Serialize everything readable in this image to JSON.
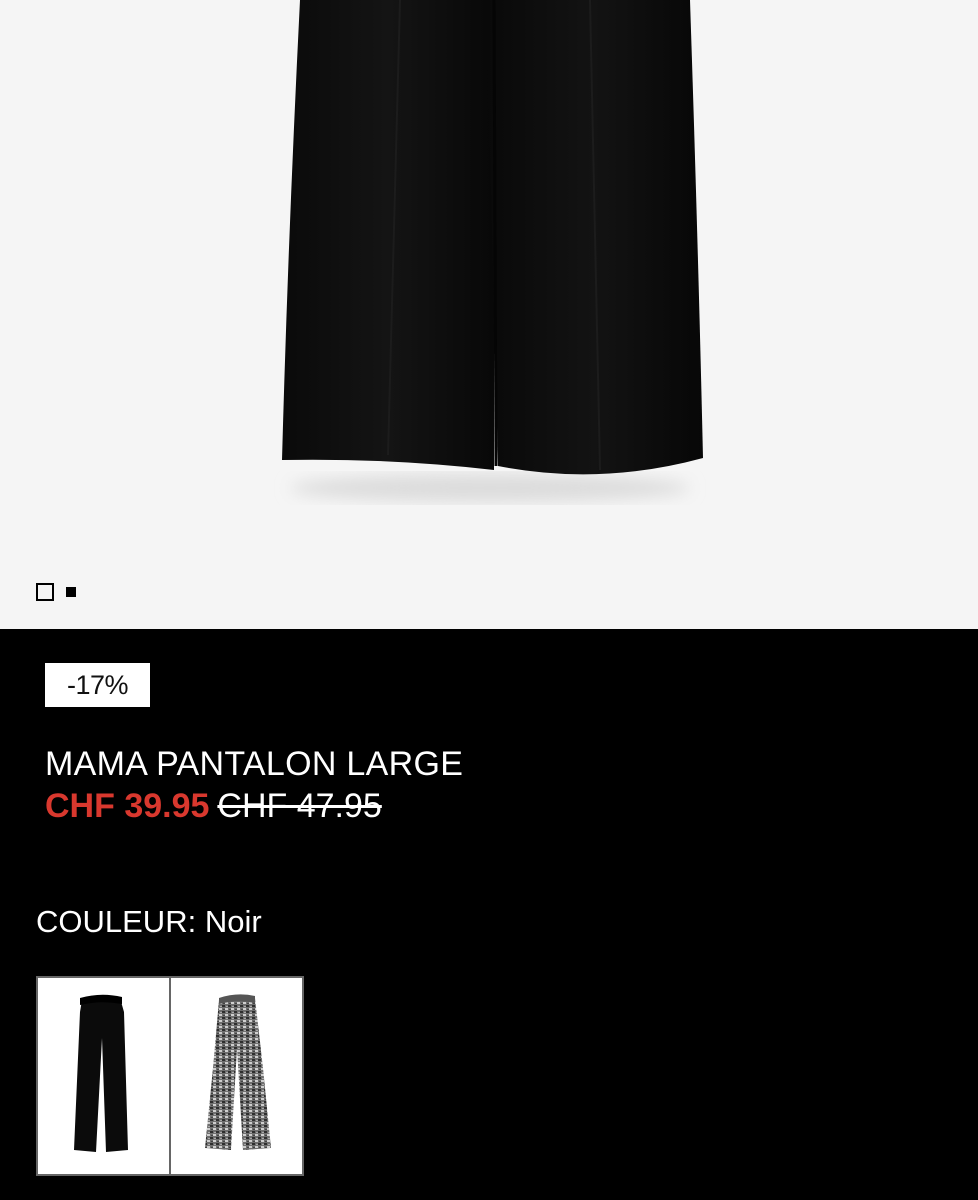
{
  "gallery": {
    "image_icon": "product-photo-black-wide-leg-trousers",
    "dots": [
      "gallery-dot-1",
      "gallery-dot-2"
    ]
  },
  "product": {
    "discount_badge": "-17%",
    "title": "MAMA PANTALON LARGE",
    "price_sale": "CHF 39.95",
    "price_original": "CHF 47.95",
    "color_label": "COULEUR:",
    "color_value": "Noir"
  },
  "swatches": [
    {
      "icon": "black-trousers-thumbnail"
    },
    {
      "icon": "grey-tweed-trousers-thumbnail"
    }
  ],
  "colors": {
    "sale": "#d9382e",
    "info_bg": "#000000",
    "gallery_bg": "#f5f5f5"
  }
}
